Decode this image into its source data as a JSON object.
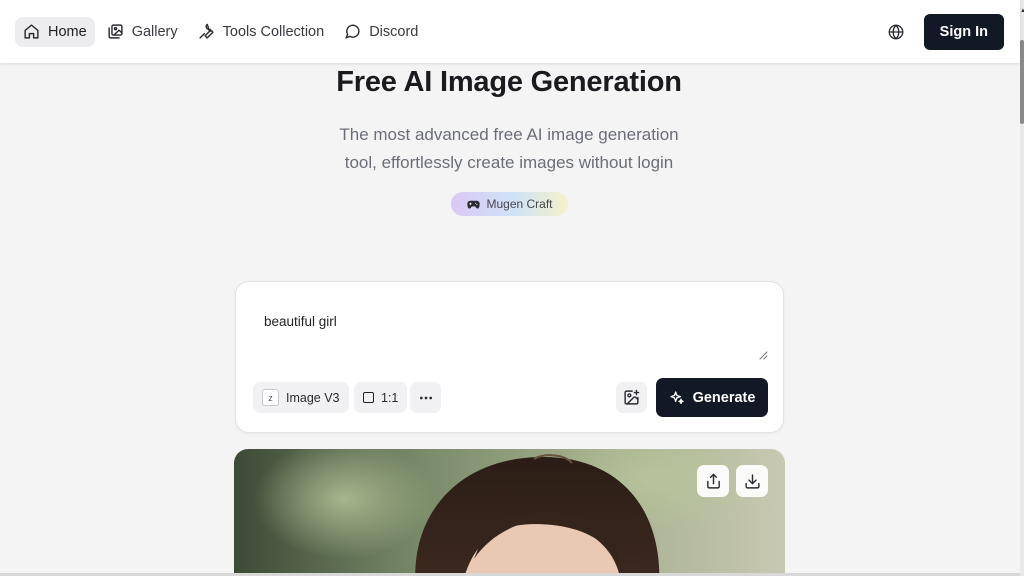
{
  "nav": {
    "items": [
      {
        "label": "Home",
        "icon": "home-icon",
        "active": true
      },
      {
        "label": "Gallery",
        "icon": "gallery-icon",
        "active": false
      },
      {
        "label": "Tools Collection",
        "icon": "wrench-icon",
        "active": false
      },
      {
        "label": "Discord",
        "icon": "chat-bubble-icon",
        "active": false
      }
    ],
    "language_icon": "globe-icon",
    "sign_in_label": "Sign In"
  },
  "hero": {
    "title": "Free AI Image Generation",
    "subtitle_line1": "The most advanced free AI image generation",
    "subtitle_line2": "tool, effortlessly create images without login",
    "badge_label": "Mugen Craft",
    "badge_icon": "gamepad-icon"
  },
  "prompt_card": {
    "prompt_value": "beautiful girl",
    "model_logo_letter": "z",
    "model_label": "Image V3",
    "ratio_label": "1:1",
    "more_icon": "ellipsis-icon",
    "upload_icon": "image-plus-icon",
    "generate_label": "Generate",
    "generate_icon": "sparkle-icon"
  },
  "preview": {
    "share_icon": "share-icon",
    "download_icon": "download-icon"
  },
  "colors": {
    "primary_dark": "#131827",
    "page_bg": "#f4f4f4",
    "badge_gradient": [
      "#d9c8f5",
      "#cfe3f7",
      "#f6f1c8"
    ]
  }
}
